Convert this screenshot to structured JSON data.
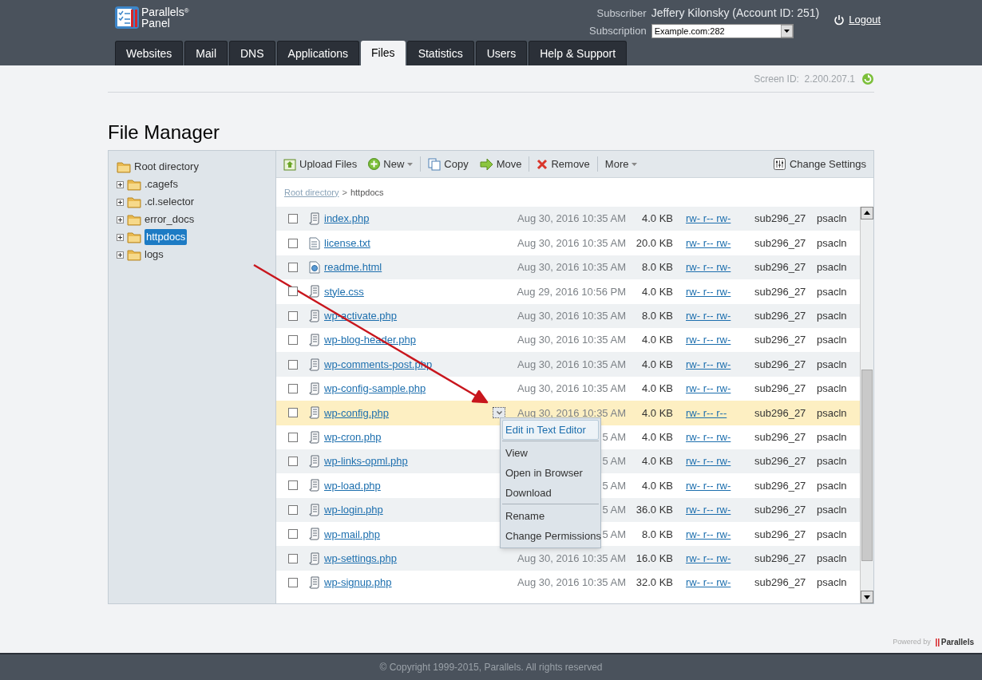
{
  "header": {
    "logo": {
      "line1": "Parallels",
      "mark": "®",
      "line2": "Panel"
    },
    "subscriber_label": "Subscriber",
    "subscriber_value": "Jeffery Kilonsky (Account ID: 251)",
    "subscription_label": "Subscription",
    "subscription_value": "Example.com:282",
    "logout": "Logout"
  },
  "tabs": [
    {
      "label": "Websites",
      "selected": false
    },
    {
      "label": "Mail",
      "selected": false
    },
    {
      "label": "DNS",
      "selected": false
    },
    {
      "label": "Applications",
      "selected": false
    },
    {
      "label": "Files",
      "selected": true
    },
    {
      "label": "Statistics",
      "selected": false
    },
    {
      "label": "Users",
      "selected": false
    },
    {
      "label": "Help & Support",
      "selected": false
    }
  ],
  "screen_id": "Screen ID:  2.200.207.1",
  "page_title": "File Manager",
  "tree": {
    "label": "Root directory",
    "children": [
      {
        "label": ".cagefs",
        "selected": false
      },
      {
        "label": ".cl.selector",
        "selected": false
      },
      {
        "label": "error_docs",
        "selected": false
      },
      {
        "label": "httpdocs",
        "selected": true
      },
      {
        "label": "logs",
        "selected": false
      }
    ]
  },
  "toolbar": {
    "groups": [
      [
        {
          "label": "Upload Files",
          "kind": "button"
        },
        {
          "label": "New",
          "kind": "menu"
        }
      ],
      [
        {
          "label": "Copy",
          "kind": "button"
        },
        {
          "label": "Move",
          "kind": "button"
        }
      ],
      [
        {
          "label": "Remove",
          "kind": "button"
        }
      ],
      [
        {
          "label": "More",
          "kind": "menu"
        }
      ]
    ],
    "settings": "Change Settings"
  },
  "breadcrumb": {
    "link": "Root directory",
    "separator": ">",
    "current": "httpdocs"
  },
  "files": [
    {
      "name": "index.php",
      "kind": "script",
      "date": "Aug 30, 2016 10:35 AM",
      "size": "4.0 KB",
      "permissions": "rw- r-- rw-",
      "owner": "sub296_27",
      "group": "psacln",
      "checked": false,
      "selected": false
    },
    {
      "name": "license.txt",
      "kind": "text",
      "date": "Aug 30, 2016 10:35 AM",
      "size": "20.0 KB",
      "permissions": "rw- r-- rw-",
      "owner": "sub296_27",
      "group": "psacln",
      "checked": false,
      "selected": false
    },
    {
      "name": "readme.html",
      "kind": "html",
      "date": "Aug 30, 2016 10:35 AM",
      "size": "8.0 KB",
      "permissions": "rw- r-- rw-",
      "owner": "sub296_27",
      "group": "psacln",
      "checked": false,
      "selected": false
    },
    {
      "name": "style.css",
      "kind": "script",
      "date": "Aug 29, 2016 10:56 PM",
      "size": "4.0 KB",
      "permissions": "rw- r-- rw-",
      "owner": "sub296_27",
      "group": "psacln",
      "checked": false,
      "selected": false
    },
    {
      "name": "wp-activate.php",
      "kind": "script",
      "date": "Aug 30, 2016 10:35 AM",
      "size": "8.0 KB",
      "permissions": "rw- r-- rw-",
      "owner": "sub296_27",
      "group": "psacln",
      "checked": false,
      "selected": false
    },
    {
      "name": "wp-blog-header.php",
      "kind": "script",
      "date": "Aug 30, 2016 10:35 AM",
      "size": "4.0 KB",
      "permissions": "rw- r-- rw-",
      "owner": "sub296_27",
      "group": "psacln",
      "checked": false,
      "selected": false
    },
    {
      "name": "wp-comments-post.php",
      "kind": "script",
      "date": "Aug 30, 2016 10:35 AM",
      "size": "4.0 KB",
      "permissions": "rw- r-- rw-",
      "owner": "sub296_27",
      "group": "psacln",
      "checked": false,
      "selected": false
    },
    {
      "name": "wp-config-sample.php",
      "kind": "script",
      "date": "Aug 30, 2016 10:35 AM",
      "size": "4.0 KB",
      "permissions": "rw- r-- rw-",
      "owner": "sub296_27",
      "group": "psacln",
      "checked": false,
      "selected": false
    },
    {
      "name": "wp-config.php",
      "kind": "script",
      "date": "Aug 30, 2016 10:35 AM",
      "size": "4.0 KB",
      "permissions": "rw- r-- r--",
      "owner": "sub296_27",
      "group": "psacln",
      "checked": false,
      "selected": true
    },
    {
      "name": "wp-cron.php",
      "kind": "script",
      "date": "5 AM",
      "size": "4.0 KB",
      "permissions": "rw- r-- rw-",
      "owner": "sub296_27",
      "group": "psacln",
      "checked": false,
      "selected": false
    },
    {
      "name": "wp-links-opml.php",
      "kind": "script",
      "date": "5 AM",
      "size": "4.0 KB",
      "permissions": "rw- r-- rw-",
      "owner": "sub296_27",
      "group": "psacln",
      "checked": false,
      "selected": false
    },
    {
      "name": "wp-load.php",
      "kind": "script",
      "date": "5 AM",
      "size": "4.0 KB",
      "permissions": "rw- r-- rw-",
      "owner": "sub296_27",
      "group": "psacln",
      "checked": false,
      "selected": false
    },
    {
      "name": "wp-login.php",
      "kind": "script",
      "date": "5 AM",
      "size": "36.0 KB",
      "permissions": "rw- r-- rw-",
      "owner": "sub296_27",
      "group": "psacln",
      "checked": false,
      "selected": false
    },
    {
      "name": "wp-mail.php",
      "kind": "script",
      "date": "5 AM",
      "size": "8.0 KB",
      "permissions": "rw- r-- rw-",
      "owner": "sub296_27",
      "group": "psacln",
      "checked": false,
      "selected": false
    },
    {
      "name": "wp-settings.php",
      "kind": "script",
      "date": "Aug 30, 2016 10:35 AM",
      "size": "16.0 KB",
      "permissions": "rw- r-- rw-",
      "owner": "sub296_27",
      "group": "psacln",
      "checked": false,
      "selected": false
    },
    {
      "name": "wp-signup.php",
      "kind": "script",
      "date": "Aug 30, 2016 10:35 AM",
      "size": "32.0 KB",
      "permissions": "rw- r-- rw-",
      "owner": "sub296_27",
      "group": "psacln",
      "checked": false,
      "selected": false
    }
  ],
  "context_menu": {
    "groups": [
      [
        {
          "label": "Edit in Text Editor",
          "selected": true
        }
      ],
      [
        {
          "label": "View",
          "selected": false
        },
        {
          "label": "Open in Browser",
          "selected": false
        },
        {
          "label": "Download",
          "selected": false
        }
      ],
      [
        {
          "label": "Rename",
          "selected": false
        },
        {
          "label": "Change Permissions",
          "selected": false
        }
      ]
    ]
  },
  "footer": {
    "powered_by": "Powered by",
    "brand": "Parallels",
    "copyright": "© Copyright 1999-2015, Parallels. All rights reserved"
  }
}
